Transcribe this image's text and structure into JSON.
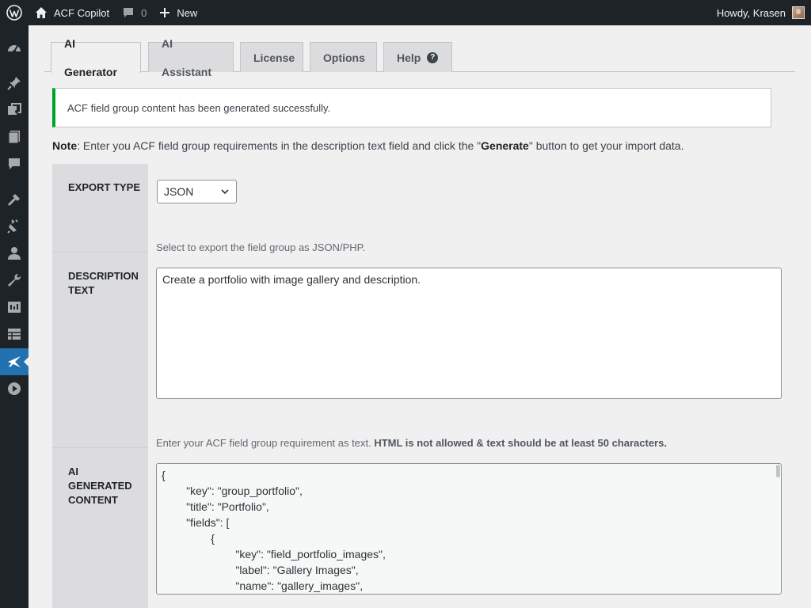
{
  "adminbar": {
    "site_name": "ACF Copilot",
    "comments_count": "0",
    "new_label": "New",
    "howdy": "Howdy, Krasen"
  },
  "menu_icons": [
    "dashboard-icon",
    "pin-icon",
    "media-icon",
    "pages-icon",
    "comments-icon",
    "appearance-icon",
    "plugins-icon",
    "users-icon",
    "tools-icon",
    "settings-icon",
    "acf-icon",
    "acf-copilot-icon",
    "play-icon"
  ],
  "tabs": [
    {
      "label": "AI Generator",
      "active": true
    },
    {
      "label": "AI Assistant",
      "active": false
    },
    {
      "label": "License",
      "active": false
    },
    {
      "label": "Options",
      "active": false
    },
    {
      "label": "Help",
      "active": false
    }
  ],
  "notice": {
    "text": "ACF field group content has been generated successfully.",
    "color": "#00a32a"
  },
  "note": {
    "label": "Note",
    "text_before": ": Enter you ACF field group requirements in the description text field and click the \"",
    "button_word": "Generate",
    "text_after": "\" button to get your import data."
  },
  "form": {
    "export_type": {
      "label": "EXPORT TYPE",
      "value": "JSON",
      "description": "Select to export the field group as JSON/PHP."
    },
    "description_text": {
      "label_line1": "DESCRIPTION",
      "label_line2": "TEXT",
      "value": "Create a portfolio with image gallery and description.",
      "hint_plain": "Enter your ACF field group requirement as text. ",
      "hint_bold": "HTML is not allowed & text should be at least 50 characters."
    },
    "ai_content": {
      "label_line1": "AI",
      "label_line2": "GENERATED",
      "label_line3": "CONTENT",
      "lines": [
        "{",
        "        \"key\": \"group_portfolio\",",
        "        \"title\": \"Portfolio\",",
        "        \"fields\": [",
        "                {",
        "                        \"key\": \"field_portfolio_images\",",
        "                        \"label\": \"Gallery Images\",",
        "                        \"name\": \"gallery_images\","
      ]
    }
  },
  "colors": {
    "admin_dark": "#1d2327",
    "accent": "#2271b1",
    "success": "#00a32a"
  }
}
